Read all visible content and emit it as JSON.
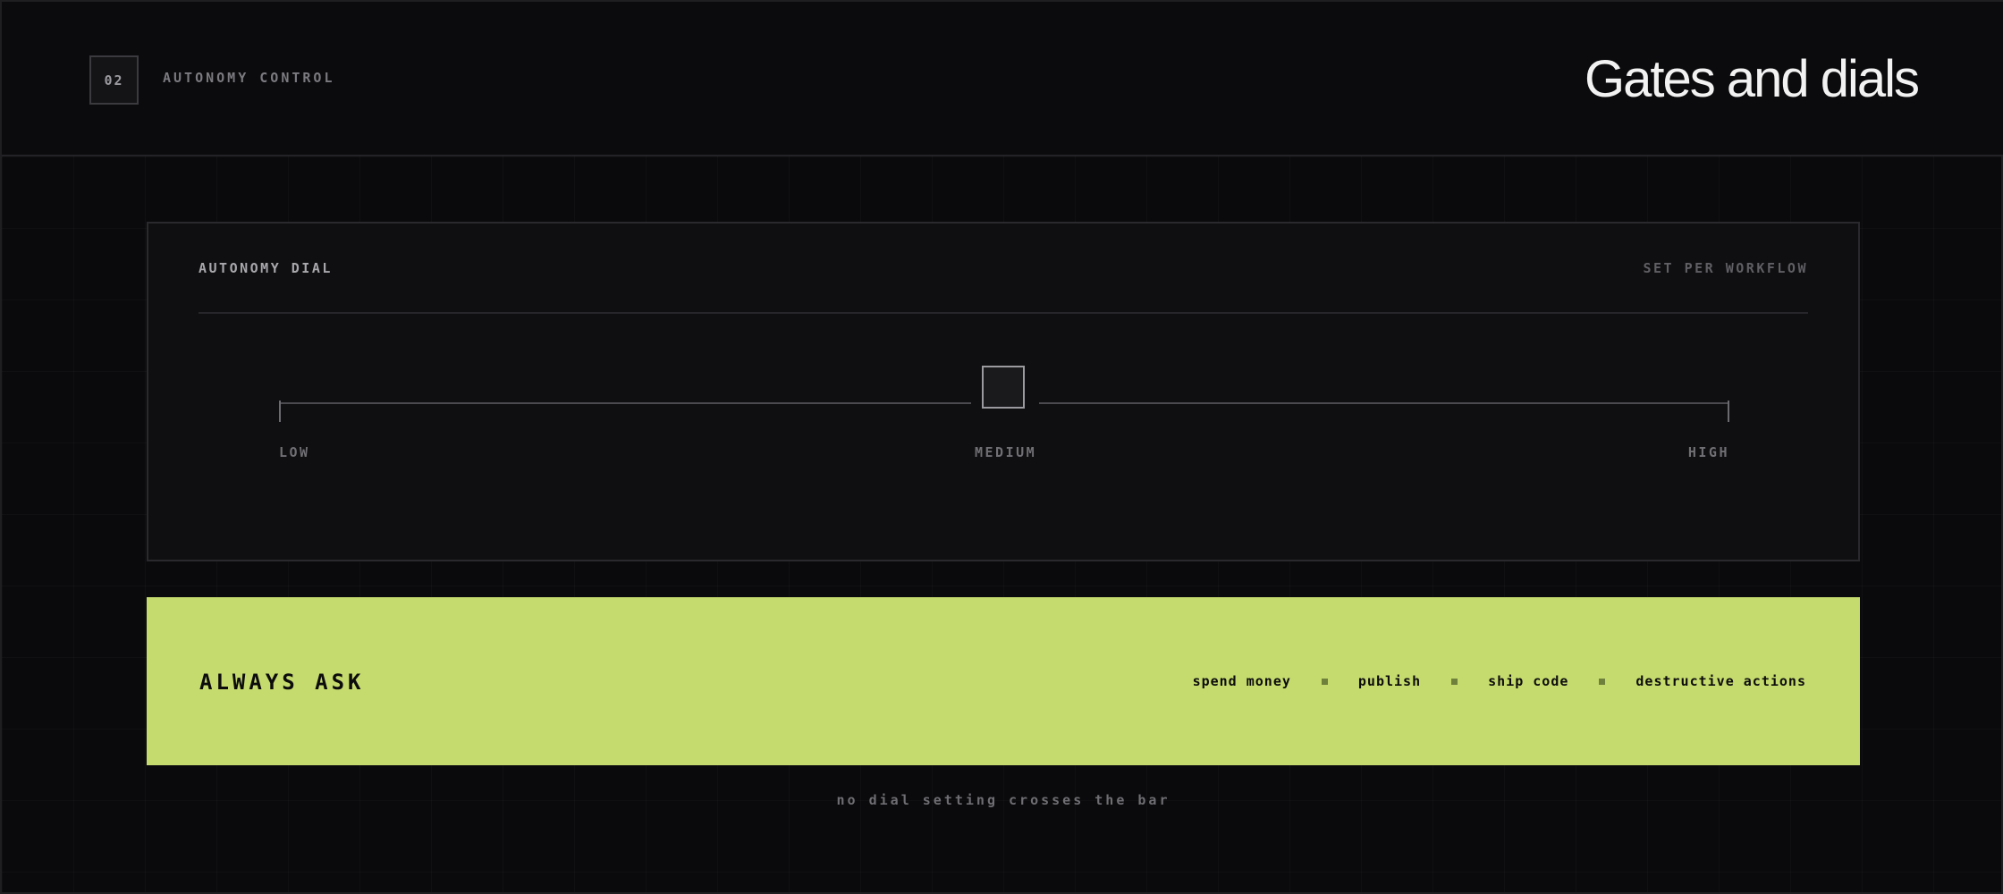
{
  "header": {
    "section_number": "02",
    "section_label": "AUTONOMY CONTROL",
    "title": "Gates and dials"
  },
  "dial": {
    "label": "AUTONOMY DIAL",
    "note": "SET PER WORKFLOW",
    "levels": [
      "LOW",
      "MEDIUM",
      "HIGH"
    ],
    "current_level": "MEDIUM"
  },
  "always_ask": {
    "title": "ALWAYS ASK",
    "items": [
      "spend money",
      "publish",
      "ship code",
      "destructive actions"
    ]
  },
  "footnote": "no dial setting crosses the bar",
  "colors": {
    "background": "#0a0a0c",
    "accent": "#c5db6e",
    "text": "#f2f2f2"
  }
}
